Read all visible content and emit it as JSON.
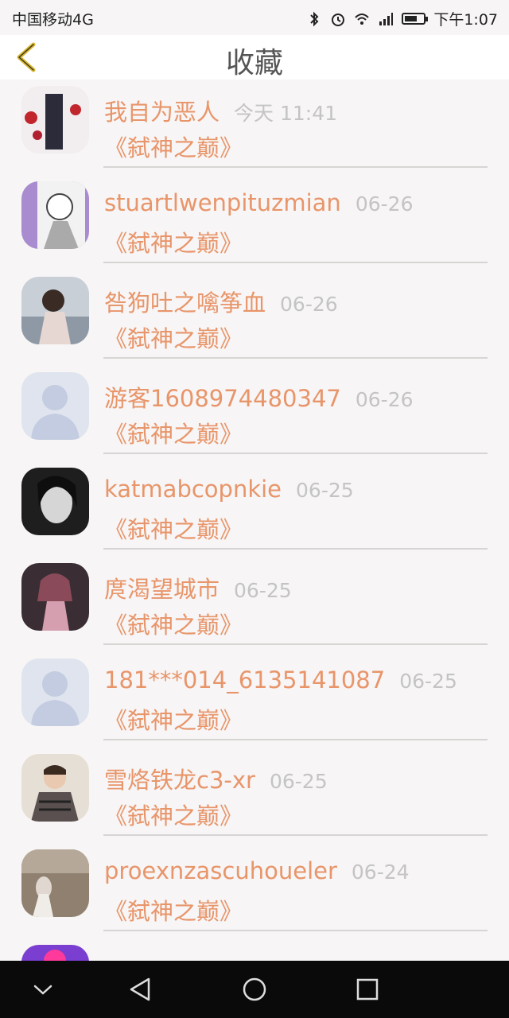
{
  "status_bar": {
    "carrier": "中国移动4G",
    "time": "下午1:07",
    "icons": [
      "bluetooth-icon",
      "alarm-icon",
      "wifi-icon",
      "signal-icon",
      "battery-icon"
    ]
  },
  "header": {
    "title": "收藏",
    "back_icon": "chevron-left-icon"
  },
  "favorites": [
    {
      "name": "我自为恶人",
      "time": "今天 11:41",
      "book": "《弑神之巅》",
      "avatar": "photo"
    },
    {
      "name": "stuartlwenpituzmian",
      "time": "06-26",
      "book": "《弑神之巅》",
      "avatar": "anime"
    },
    {
      "name": "咎狗吐之噙筝血",
      "time": "06-26",
      "book": "《弑神之巅》",
      "avatar": "photo"
    },
    {
      "name": "游客1608974480347",
      "time": "06-26",
      "book": "《弑神之巅》",
      "avatar": "default"
    },
    {
      "name": "katmabcopnkie",
      "time": "06-25",
      "book": "《弑神之巅》",
      "avatar": "photo"
    },
    {
      "name": "庹渴望城市",
      "time": "06-25",
      "book": "《弑神之巅》",
      "avatar": "anime"
    },
    {
      "name": "181***014_6135141087",
      "time": "06-25",
      "book": "《弑神之巅》",
      "avatar": "default"
    },
    {
      "name": "雪烙铁龙c3-xr",
      "time": "06-25",
      "book": "《弑神之巅》",
      "avatar": "photo"
    },
    {
      "name": "proexnzascuhoueler",
      "time": "06-24",
      "book": "《弑神之巅》",
      "avatar": "photo"
    },
    {
      "name": "",
      "time": "",
      "book": "",
      "avatar": "photo"
    }
  ],
  "system_nav": [
    "chevron-down-icon",
    "back-triangle-icon",
    "home-circle-icon",
    "recents-square-icon"
  ],
  "colors": {
    "accent": "#e8956a",
    "time": "#c4c4c4",
    "back_icon": "#d9b533"
  }
}
